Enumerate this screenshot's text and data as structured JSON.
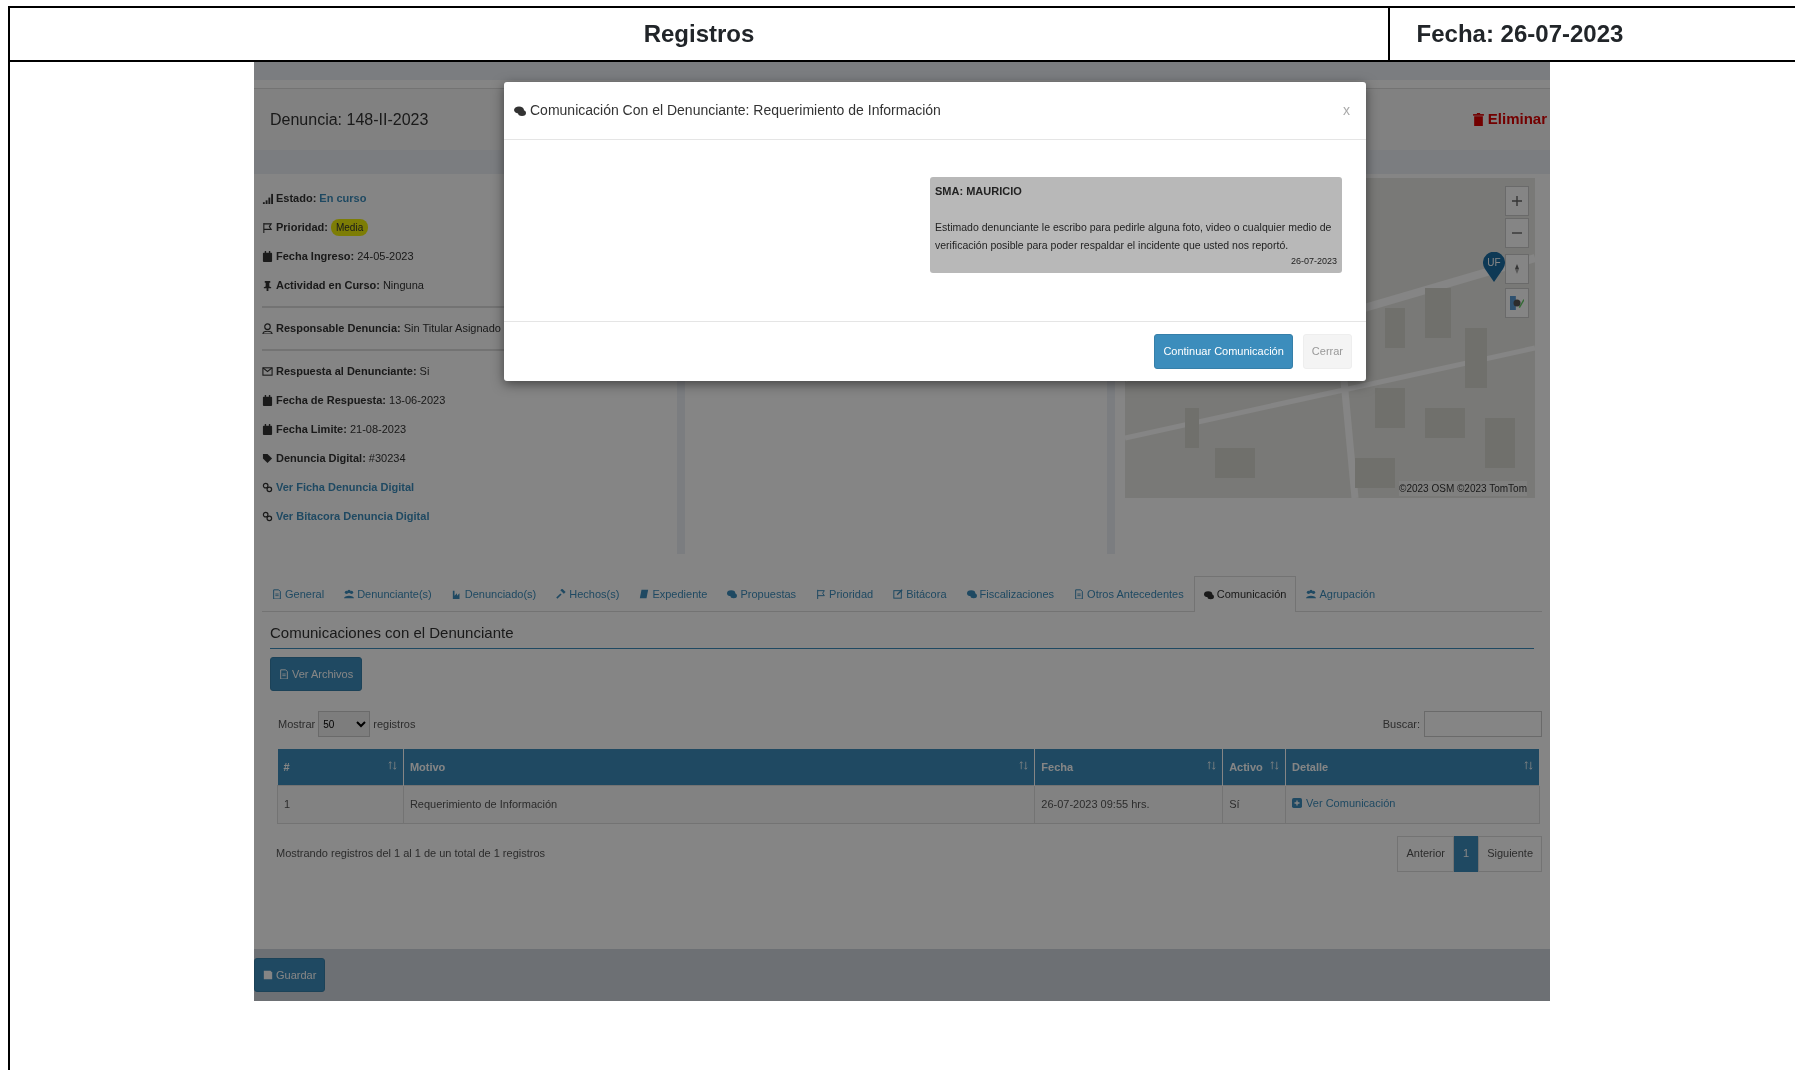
{
  "document": {
    "title": "Registros",
    "date": "Fecha: 26-07-2023"
  },
  "complaint": {
    "title": "Denuncia: 148-II-2023",
    "delete_link": "Eliminar"
  },
  "info_groups": [
    [
      {
        "label": "Estado:",
        "value": "En curso",
        "kind": "status"
      },
      {
        "label": "Prioridad:",
        "value": "Media",
        "kind": "badge"
      },
      {
        "label": "Fecha Ingreso:",
        "value": "24-05-2023",
        "kind": "text"
      },
      {
        "label": "Actividad en Curso:",
        "value": "Ninguna",
        "kind": "text"
      }
    ],
    [
      {
        "label": "Responsable Denuncia:",
        "value": "Sin Titular Asignado",
        "kind": "text"
      }
    ],
    [
      {
        "label": "Respuesta al Denunciante:",
        "value": "Si",
        "kind": "text"
      },
      {
        "label": "Fecha de Respuesta:",
        "value": "13-06-2023",
        "kind": "text"
      },
      {
        "label": "Fecha Limite:",
        "value": "21-08-2023",
        "kind": "text"
      },
      {
        "label": "Denuncia Digital:",
        "value": "#30234",
        "kind": "text"
      },
      {
        "value": "Ver Ficha Denuncia Digital",
        "kind": "link"
      },
      {
        "value": "Ver Bitacora Denuncia Digital",
        "kind": "link"
      }
    ]
  ],
  "map": {
    "marker_label": "UF",
    "attribution": "©2023 OSM ©2023 TomTom"
  },
  "tabs": [
    {
      "label": "General",
      "selected": false
    },
    {
      "label": "Denunciante(s)",
      "selected": false
    },
    {
      "label": "Denunciado(s)",
      "selected": false
    },
    {
      "label": "Hechos(s)",
      "selected": false
    },
    {
      "label": "Expediente",
      "selected": false
    },
    {
      "label": "Propuestas",
      "selected": false
    },
    {
      "label": "Prioridad",
      "selected": false
    },
    {
      "label": "Bitácora",
      "selected": false
    },
    {
      "label": "Fiscalizaciones",
      "selected": false
    },
    {
      "label": "Otros Antecedentes",
      "selected": false
    },
    {
      "label": "Comunicación",
      "selected": true
    },
    {
      "label": "Agrupación",
      "selected": false
    }
  ],
  "section": {
    "title": "Comunicaciones con el Denunciante",
    "files_button": "Ver Archivos"
  },
  "table_controls": {
    "show_label": "Mostrar",
    "page_size": "50",
    "records_label": "registros",
    "search_label": "Buscar:"
  },
  "table": {
    "columns": [
      "#",
      "Motivo",
      "Fecha",
      "Activo",
      "Detalle"
    ],
    "rows": [
      [
        "1",
        "Requerimiento de Información",
        "26-07-2023 09:55 hrs.",
        "Sí",
        "Ver Comunicación"
      ]
    ]
  },
  "table_info": "Mostrando registros del 1 al 1 de un total de 1 registros",
  "pagination": [
    {
      "label": "Anterior",
      "selected": false
    },
    {
      "label": "1",
      "selected": true
    },
    {
      "label": "Siguiente",
      "selected": false
    }
  ],
  "save_button": "Guardar",
  "modal": {
    "title": "Comunicación Con el Denunciante: Requerimiento de Información",
    "close": "x",
    "messages": [
      {
        "sender": "SMA: MAURICIO",
        "text": "Estimado denunciante le escribo para pedirle alguna foto, video o cualquier medio de verificación posible para poder respaldar el incidente que usted nos reportó.",
        "date": "26-07-2023"
      }
    ],
    "buttons": [
      {
        "label": "Continuar Comunicación",
        "kind": "primary"
      },
      {
        "label": "Cerrar",
        "kind": "secondary"
      }
    ]
  }
}
